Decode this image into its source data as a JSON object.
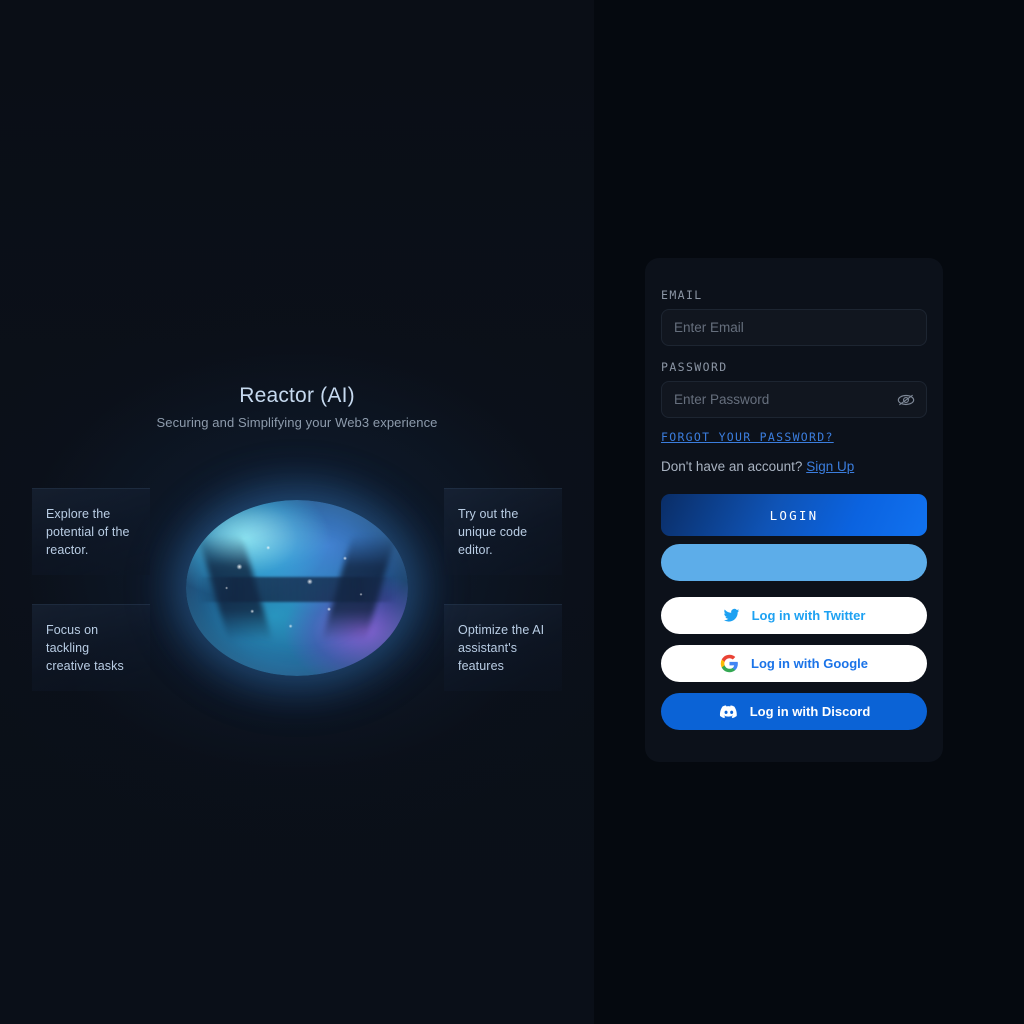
{
  "hero": {
    "title": "Reactor (AI)",
    "subtitle": "Securing and Simplifying your Web3 experience"
  },
  "features": [
    {
      "id": "explore-potential",
      "text": "Explore the potential of the reactor."
    },
    {
      "id": "focus-creative",
      "text": "Focus on tackling creative tasks"
    },
    {
      "id": "code-editor",
      "text": "Try out the unique code editor."
    },
    {
      "id": "optimize-ai",
      "text": "Optimize the AI assistant's features"
    }
  ],
  "form": {
    "email_label": "EMAIL",
    "email_placeholder": "Enter Email",
    "email_value": "",
    "password_label": "PASSWORD",
    "password_placeholder": "Enter Password",
    "password_value": "",
    "password_visibility_icon": "eye-off-icon",
    "forgot_password": "FORGOT YOUR PASSWORD?",
    "account_prompt": "Don't have an account?",
    "signup_label": "Sign Up",
    "login_button": "LOGIN",
    "loading_button_label": ""
  },
  "oauth": [
    {
      "id": "twitter",
      "label": "Log in with Twitter",
      "icon": "twitter-icon"
    },
    {
      "id": "google",
      "label": "Log in with Google",
      "icon": "google-icon"
    },
    {
      "id": "discord",
      "label": "Log in with Discord",
      "icon": "discord-icon"
    }
  ],
  "colors": {
    "left_panel_bg": "#0b1019",
    "right_panel_bg": "#05090f",
    "card_bg": "#0c111a",
    "accent_blue": "#3b7ddd",
    "login_gradient_start": "#0a2d66",
    "login_gradient_end": "#1172f0",
    "skeleton_blue": "#5dade9",
    "twitter_blue": "#1da1f2",
    "google_blue": "#1a73e8",
    "discord_blue": "#0b63d6"
  }
}
